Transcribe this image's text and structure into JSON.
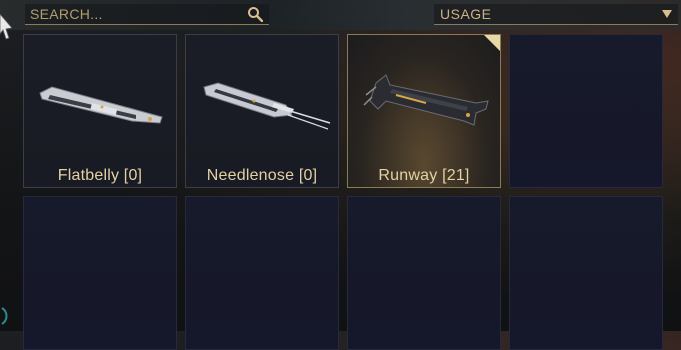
{
  "search": {
    "placeholder": "SEARCH...",
    "icon": "search-icon"
  },
  "sort": {
    "value": "USAGE",
    "icon": "triangle-down-icon"
  },
  "tiles": [
    {
      "label": "Flatbelly [0]",
      "state": "normal"
    },
    {
      "label": "Needlenose [0]",
      "state": "normal"
    },
    {
      "label": "Runway [21]",
      "state": "selected"
    },
    {
      "label": "",
      "state": "empty"
    },
    {
      "label": "",
      "state": "empty"
    },
    {
      "label": "",
      "state": "empty"
    },
    {
      "label": "",
      "state": "empty"
    },
    {
      "label": "",
      "state": "empty"
    }
  ],
  "colors": {
    "accent": "#c9b283",
    "label": "#e3d1a4",
    "selected_corner": "#e8d8a8"
  }
}
